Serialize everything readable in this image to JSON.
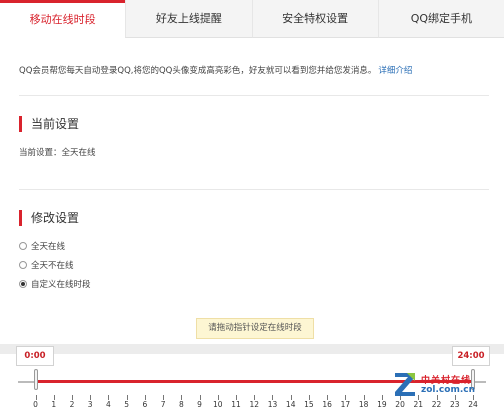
{
  "tabs": [
    {
      "label": "移动在线时段",
      "active": true
    },
    {
      "label": "好友上线提醒",
      "active": false
    },
    {
      "label": "安全特权设置",
      "active": false
    },
    {
      "label": "QQ绑定手机",
      "active": false
    }
  ],
  "intro": {
    "text": "QQ会员帮您每天自动登录QQ,将您的QQ头像变成高亮彩色，好友就可以看到您并给您发消息。",
    "link": "详细介绍"
  },
  "current_section": {
    "title": "当前设置",
    "value": "当前设置：全天在线"
  },
  "modify_section": {
    "title": "修改设置",
    "options": [
      {
        "label": "全天在线",
        "checked": false
      },
      {
        "label": "全天不在线",
        "checked": false
      },
      {
        "label": "自定义在线时段",
        "checked": true
      }
    ]
  },
  "slider": {
    "tip": "请拖动指针设定在线时段",
    "start_time": "0:00",
    "end_time": "24:00",
    "range": [
      0,
      24
    ],
    "ticks": [
      "0",
      "1",
      "2",
      "3",
      "4",
      "5",
      "6",
      "7",
      "8",
      "9",
      "10",
      "11",
      "12",
      "13",
      "14",
      "15",
      "16",
      "17",
      "18",
      "19",
      "20",
      "21",
      "22",
      "23",
      "24"
    ]
  },
  "watermark": {
    "line1": "中关村在线",
    "line2": "zol.com.cn"
  },
  "colors": {
    "accent": "#d9232d",
    "link": "#2b6fb6"
  }
}
